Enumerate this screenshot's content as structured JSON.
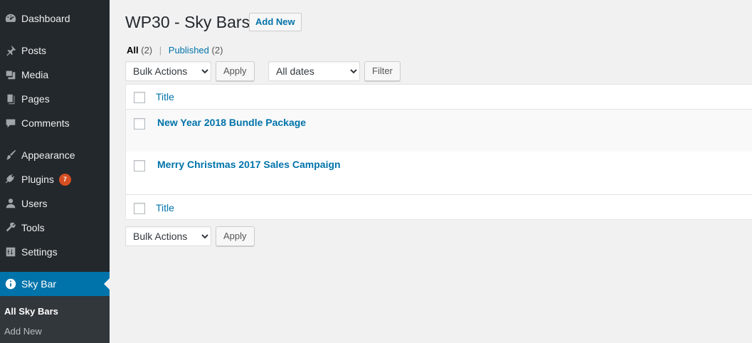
{
  "sidebar": {
    "items": [
      {
        "label": "Dashboard",
        "icon": "dashboard-icon"
      },
      {
        "label": "Posts",
        "icon": "pin-icon"
      },
      {
        "label": "Media",
        "icon": "media-icon"
      },
      {
        "label": "Pages",
        "icon": "pages-icon"
      },
      {
        "label": "Comments",
        "icon": "comment-icon"
      },
      {
        "label": "Appearance",
        "icon": "paintbrush-icon"
      },
      {
        "label": "Plugins",
        "icon": "plug-icon",
        "badge": "7"
      },
      {
        "label": "Users",
        "icon": "user-icon"
      },
      {
        "label": "Tools",
        "icon": "wrench-icon"
      },
      {
        "label": "Settings",
        "icon": "settings-icon"
      },
      {
        "label": "Sky Bar",
        "icon": "info-icon"
      }
    ],
    "submenu": [
      {
        "label": "All Sky Bars"
      },
      {
        "label": "Add New"
      }
    ]
  },
  "main": {
    "title": "WP30 - Sky Bars",
    "add_new": "Add New",
    "views": {
      "all_label": "All",
      "all_count": "(2)",
      "separator": "|",
      "published_label": "Published",
      "published_count": "(2)"
    },
    "top_nav": {
      "bulk_actions": "Bulk Actions",
      "apply": "Apply",
      "dates": "All dates",
      "filter": "Filter"
    },
    "table": {
      "column_title": "Title",
      "rows": [
        {
          "title": "New Year 2018 Bundle Package"
        },
        {
          "title": "Merry Christmas 2017 Sales Campaign"
        }
      ]
    },
    "bottom_nav": {
      "bulk_actions": "Bulk Actions",
      "apply": "Apply"
    }
  },
  "colors": {
    "sidebar_bg": "#23282d",
    "accent": "#0073aa",
    "badge": "#d54e21",
    "page_bg": "#f1f1f1"
  }
}
